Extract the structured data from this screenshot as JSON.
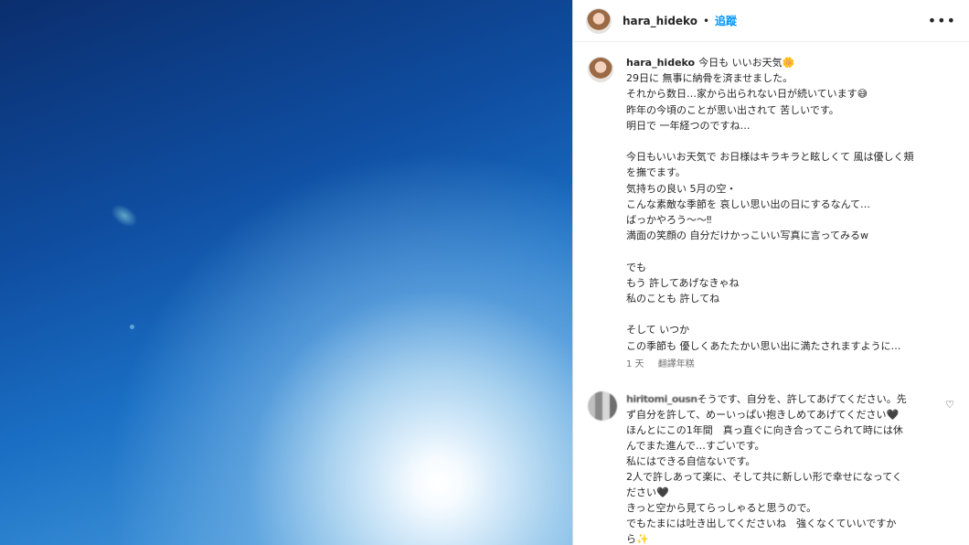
{
  "header": {
    "username": "hara_hideko",
    "separator": "•",
    "follow_label": "追蹤",
    "more_label": "•••"
  },
  "post": {
    "username": "hara_hideko",
    "first_line": "今日も いいお天気🌼",
    "caption_lines": [
      "29日に 無事に納骨を済ませました。",
      "それから数日…家から出られない日が続いています😅",
      "昨年の今頃のことが思い出されて 苦しいです。",
      "明日で 一年経つのですね…",
      "",
      "今日もいいお天気で お日様はキラキラと眩しくて 風は優しく頬",
      "を撫でます。",
      "気持ちの良い 5月の空・",
      "こんな素敵な季節を 哀しい思い出の日にするなんて…",
      "ばっかやろう〜〜‼",
      "満面の笑顔の 自分だけかっこいい写真に言ってみるw",
      "",
      "でも",
      "もう 許してあげなきゃね",
      "私のことも 許してね",
      "",
      "そして いつか",
      "この季節も 優しくあたたかい思い出に満たされますように…"
    ],
    "time_label": "1 天",
    "translate_label": "翻譯年糕"
  },
  "comment": {
    "username": "hiritomi_ousn",
    "lines": [
      "そうです、自分を、許してあげてください。先",
      "ず自分を許して、めーいっぱい抱きしめてあげてください🖤",
      "ほんとにこの1年間　真っ直ぐに向き合ってこられて時には休",
      "んでまた進んで…すごいです。",
      "私にはできる自信ないです。",
      "2人で許しあって楽に、そして共に新しい形で幸せになってく",
      "ださい🖤",
      "きっと空から見てらっしゃると思うので。",
      "でもたまには吐き出してくださいね　強くなくていいですか",
      "ら✨"
    ],
    "like_icon": "heart-icon"
  }
}
